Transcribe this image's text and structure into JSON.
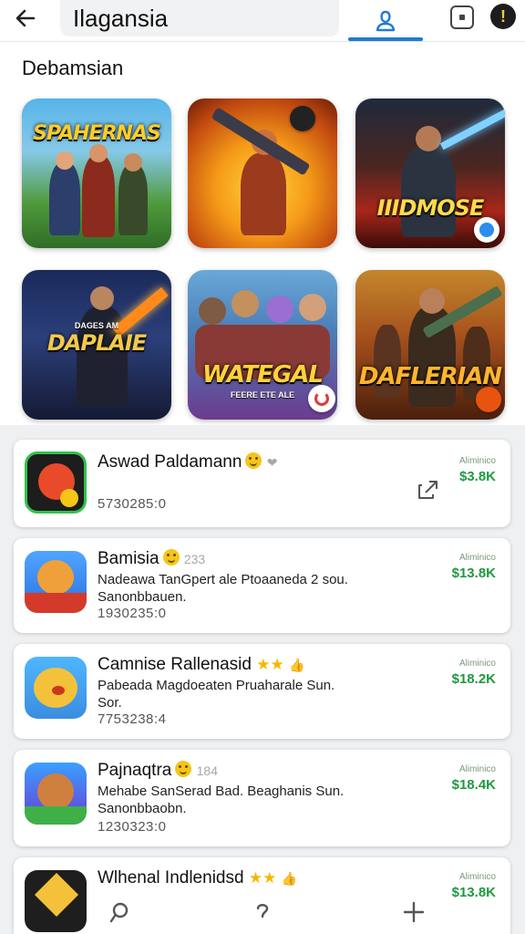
{
  "header": {
    "search_value": "Ilagansia",
    "back_icon": "arrow-left-icon",
    "profile_icon": "person-icon",
    "action_icon": "square-icon",
    "menu_icon": "info-icon"
  },
  "section": {
    "title": "Debamsian"
  },
  "games": [
    {
      "label": "SPAHERNAS",
      "sub": ""
    },
    {
      "label": "",
      "sub": ""
    },
    {
      "label": "IIIDMOSE",
      "sub": ""
    },
    {
      "label": "DAPLAIE",
      "sub": "DAGES AM"
    },
    {
      "label": "WATEGAL",
      "sub": "FEERE ETE ALE"
    },
    {
      "label": "DAFLERIAN",
      "sub": ""
    }
  ],
  "apps": [
    {
      "title": "Aswad Paldamann",
      "extra": "❤",
      "desc": [],
      "meta": "5730285:0",
      "price_small": "Aliminico",
      "price": "$3.8K",
      "rating_stars": 0,
      "emoji": true
    },
    {
      "title": "Bamisia",
      "extra": "233",
      "desc": [
        "Nadeawa TanGpert ale Ptoaaneda 2 sou.",
        "Sanonbbauen."
      ],
      "meta": "1930235:0",
      "price_small": "Aliminico",
      "price": "$13.8K",
      "rating_stars": 0,
      "emoji": true
    },
    {
      "title": "Camnise Rallenasid",
      "extra": "",
      "desc": [
        "Pabeada Magdoeaten Pruaharale Sun.",
        "Sor."
      ],
      "meta": "7753238:4",
      "price_small": "Aliminico",
      "price": "$18.2K",
      "rating_stars": 2,
      "emoji": false
    },
    {
      "title": "Pajnaqtra",
      "extra": "184",
      "desc": [
        "Mehabe SanSerad Bad. Beaghanis Sun.",
        "Sanonbbaobn."
      ],
      "meta": "1230323:0",
      "price_small": "Aliminico",
      "price": "$18.4K",
      "rating_stars": 0,
      "emoji": true
    },
    {
      "title": "Wlhenal Indlenidsd",
      "extra": "",
      "desc": [],
      "meta": "",
      "price_small": "Aliminico",
      "price": "$13.8K",
      "rating_stars": 2,
      "emoji": false
    }
  ],
  "colors": {
    "accent": "#1f7bd6",
    "price": "#1e9a3e"
  }
}
